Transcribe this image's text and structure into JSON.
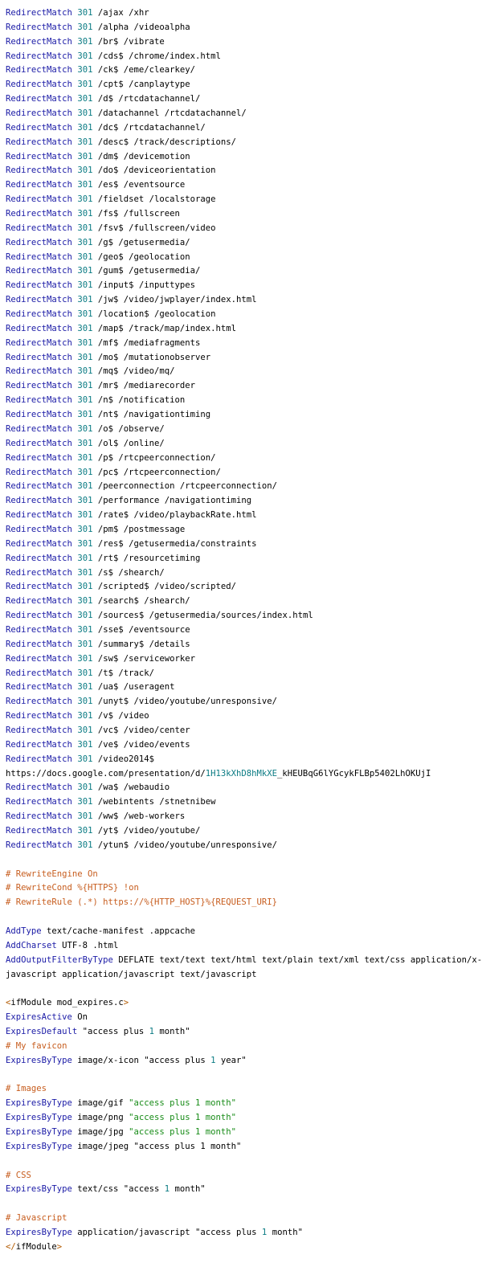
{
  "colors": {
    "background": "#ffffff",
    "keyword": "#1a1aa6",
    "number": "#0a7b83",
    "comment": "#c75d1e",
    "string": "#188c18",
    "tag": "#b35a00",
    "text": "#000000"
  },
  "lines": [
    [
      {
        "t": "RedirectMatch",
        "c": "kw"
      },
      {
        "t": " "
      },
      {
        "t": "301",
        "c": "num"
      },
      {
        "t": " /ajax /xhr"
      }
    ],
    [
      {
        "t": "RedirectMatch",
        "c": "kw"
      },
      {
        "t": " "
      },
      {
        "t": "301",
        "c": "num"
      },
      {
        "t": " /alpha /videoalpha"
      }
    ],
    [
      {
        "t": "RedirectMatch",
        "c": "kw"
      },
      {
        "t": " "
      },
      {
        "t": "301",
        "c": "num"
      },
      {
        "t": " /br$ /vibrate"
      }
    ],
    [
      {
        "t": "RedirectMatch",
        "c": "kw"
      },
      {
        "t": " "
      },
      {
        "t": "301",
        "c": "num"
      },
      {
        "t": " /cds$ /chrome/index.html"
      }
    ],
    [
      {
        "t": "RedirectMatch",
        "c": "kw"
      },
      {
        "t": " "
      },
      {
        "t": "301",
        "c": "num"
      },
      {
        "t": " /ck$ /eme/clearkey/"
      }
    ],
    [
      {
        "t": "RedirectMatch",
        "c": "kw"
      },
      {
        "t": " "
      },
      {
        "t": "301",
        "c": "num"
      },
      {
        "t": " /cpt$ /canplaytype"
      }
    ],
    [
      {
        "t": "RedirectMatch",
        "c": "kw"
      },
      {
        "t": " "
      },
      {
        "t": "301",
        "c": "num"
      },
      {
        "t": " /d$ /rtcdatachannel/"
      }
    ],
    [
      {
        "t": "RedirectMatch",
        "c": "kw"
      },
      {
        "t": " "
      },
      {
        "t": "301",
        "c": "num"
      },
      {
        "t": " /datachannel /rtcdatachannel/"
      }
    ],
    [
      {
        "t": "RedirectMatch",
        "c": "kw"
      },
      {
        "t": " "
      },
      {
        "t": "301",
        "c": "num"
      },
      {
        "t": " /dc$ /rtcdatachannel/"
      }
    ],
    [
      {
        "t": "RedirectMatch",
        "c": "kw"
      },
      {
        "t": " "
      },
      {
        "t": "301",
        "c": "num"
      },
      {
        "t": " /desc$ /track/descriptions/"
      }
    ],
    [
      {
        "t": "RedirectMatch",
        "c": "kw"
      },
      {
        "t": " "
      },
      {
        "t": "301",
        "c": "num"
      },
      {
        "t": " /dm$ /devicemotion"
      }
    ],
    [
      {
        "t": "RedirectMatch",
        "c": "kw"
      },
      {
        "t": " "
      },
      {
        "t": "301",
        "c": "num"
      },
      {
        "t": " /do$ /deviceorientation"
      }
    ],
    [
      {
        "t": "RedirectMatch",
        "c": "kw"
      },
      {
        "t": " "
      },
      {
        "t": "301",
        "c": "num"
      },
      {
        "t": " /es$ /eventsource"
      }
    ],
    [
      {
        "t": "RedirectMatch",
        "c": "kw"
      },
      {
        "t": " "
      },
      {
        "t": "301",
        "c": "num"
      },
      {
        "t": " /fieldset /localstorage"
      }
    ],
    [
      {
        "t": "RedirectMatch",
        "c": "kw"
      },
      {
        "t": " "
      },
      {
        "t": "301",
        "c": "num"
      },
      {
        "t": " /fs$ /fullscreen"
      }
    ],
    [
      {
        "t": "RedirectMatch",
        "c": "kw"
      },
      {
        "t": " "
      },
      {
        "t": "301",
        "c": "num"
      },
      {
        "t": " /fsv$ /fullscreen/video"
      }
    ],
    [
      {
        "t": "RedirectMatch",
        "c": "kw"
      },
      {
        "t": " "
      },
      {
        "t": "301",
        "c": "num"
      },
      {
        "t": " /g$ /getusermedia/"
      }
    ],
    [
      {
        "t": "RedirectMatch",
        "c": "kw"
      },
      {
        "t": " "
      },
      {
        "t": "301",
        "c": "num"
      },
      {
        "t": " /geo$ /geolocation"
      }
    ],
    [
      {
        "t": "RedirectMatch",
        "c": "kw"
      },
      {
        "t": " "
      },
      {
        "t": "301",
        "c": "num"
      },
      {
        "t": " /gum$ /getusermedia/"
      }
    ],
    [
      {
        "t": "RedirectMatch",
        "c": "kw"
      },
      {
        "t": " "
      },
      {
        "t": "301",
        "c": "num"
      },
      {
        "t": " /input$ /inputtypes"
      }
    ],
    [
      {
        "t": "RedirectMatch",
        "c": "kw"
      },
      {
        "t": " "
      },
      {
        "t": "301",
        "c": "num"
      },
      {
        "t": " /jw$ /video/jwplayer/index.html"
      }
    ],
    [
      {
        "t": "RedirectMatch",
        "c": "kw"
      },
      {
        "t": " "
      },
      {
        "t": "301",
        "c": "num"
      },
      {
        "t": " /location$ /geolocation"
      }
    ],
    [
      {
        "t": "RedirectMatch",
        "c": "kw"
      },
      {
        "t": " "
      },
      {
        "t": "301",
        "c": "num"
      },
      {
        "t": " /map$ /track/map/index.html"
      }
    ],
    [
      {
        "t": "RedirectMatch",
        "c": "kw"
      },
      {
        "t": " "
      },
      {
        "t": "301",
        "c": "num"
      },
      {
        "t": " /mf$ /mediafragments"
      }
    ],
    [
      {
        "t": "RedirectMatch",
        "c": "kw"
      },
      {
        "t": " "
      },
      {
        "t": "301",
        "c": "num"
      },
      {
        "t": " /mo$ /mutationobserver"
      }
    ],
    [
      {
        "t": "RedirectMatch",
        "c": "kw"
      },
      {
        "t": " "
      },
      {
        "t": "301",
        "c": "num"
      },
      {
        "t": " /mq$ /video/mq/"
      }
    ],
    [
      {
        "t": "RedirectMatch",
        "c": "kw"
      },
      {
        "t": " "
      },
      {
        "t": "301",
        "c": "num"
      },
      {
        "t": " /mr$ /mediarecorder"
      }
    ],
    [
      {
        "t": "RedirectMatch",
        "c": "kw"
      },
      {
        "t": " "
      },
      {
        "t": "301",
        "c": "num"
      },
      {
        "t": " /n$ /notification"
      }
    ],
    [
      {
        "t": "RedirectMatch",
        "c": "kw"
      },
      {
        "t": " "
      },
      {
        "t": "301",
        "c": "num"
      },
      {
        "t": " /nt$ /navigationtiming"
      }
    ],
    [
      {
        "t": "RedirectMatch",
        "c": "kw"
      },
      {
        "t": " "
      },
      {
        "t": "301",
        "c": "num"
      },
      {
        "t": " /o$ /observe/"
      }
    ],
    [
      {
        "t": "RedirectMatch",
        "c": "kw"
      },
      {
        "t": " "
      },
      {
        "t": "301",
        "c": "num"
      },
      {
        "t": " /ol$ /online/"
      }
    ],
    [
      {
        "t": "RedirectMatch",
        "c": "kw"
      },
      {
        "t": " "
      },
      {
        "t": "301",
        "c": "num"
      },
      {
        "t": " /p$ /rtcpeerconnection/"
      }
    ],
    [
      {
        "t": "RedirectMatch",
        "c": "kw"
      },
      {
        "t": " "
      },
      {
        "t": "301",
        "c": "num"
      },
      {
        "t": " /pc$ /rtcpeerconnection/"
      }
    ],
    [
      {
        "t": "RedirectMatch",
        "c": "kw"
      },
      {
        "t": " "
      },
      {
        "t": "301",
        "c": "num"
      },
      {
        "t": " /peerconnection /rtcpeerconnection/"
      }
    ],
    [
      {
        "t": "RedirectMatch",
        "c": "kw"
      },
      {
        "t": " "
      },
      {
        "t": "301",
        "c": "num"
      },
      {
        "t": " /performance /navigationtiming"
      }
    ],
    [
      {
        "t": "RedirectMatch",
        "c": "kw"
      },
      {
        "t": " "
      },
      {
        "t": "301",
        "c": "num"
      },
      {
        "t": " /rate$ /video/playbackRate.html"
      }
    ],
    [
      {
        "t": "RedirectMatch",
        "c": "kw"
      },
      {
        "t": " "
      },
      {
        "t": "301",
        "c": "num"
      },
      {
        "t": " /pm$ /postmessage"
      }
    ],
    [
      {
        "t": "RedirectMatch",
        "c": "kw"
      },
      {
        "t": " "
      },
      {
        "t": "301",
        "c": "num"
      },
      {
        "t": " /res$ /getusermedia/constraints"
      }
    ],
    [
      {
        "t": "RedirectMatch",
        "c": "kw"
      },
      {
        "t": " "
      },
      {
        "t": "301",
        "c": "num"
      },
      {
        "t": " /rt$ /resourcetiming"
      }
    ],
    [
      {
        "t": "RedirectMatch",
        "c": "kw"
      },
      {
        "t": " "
      },
      {
        "t": "301",
        "c": "num"
      },
      {
        "t": " /s$ /shearch/"
      }
    ],
    [
      {
        "t": "RedirectMatch",
        "c": "kw"
      },
      {
        "t": " "
      },
      {
        "t": "301",
        "c": "num"
      },
      {
        "t": " /scripted$ /video/scripted/"
      }
    ],
    [
      {
        "t": "RedirectMatch",
        "c": "kw"
      },
      {
        "t": " "
      },
      {
        "t": "301",
        "c": "num"
      },
      {
        "t": " /search$ /shearch/"
      }
    ],
    [
      {
        "t": "RedirectMatch",
        "c": "kw"
      },
      {
        "t": " "
      },
      {
        "t": "301",
        "c": "num"
      },
      {
        "t": " /sources$ /getusermedia/sources/index.html"
      }
    ],
    [
      {
        "t": "RedirectMatch",
        "c": "kw"
      },
      {
        "t": " "
      },
      {
        "t": "301",
        "c": "num"
      },
      {
        "t": " /sse$ /eventsource"
      }
    ],
    [
      {
        "t": "RedirectMatch",
        "c": "kw"
      },
      {
        "t": " "
      },
      {
        "t": "301",
        "c": "num"
      },
      {
        "t": " /summary$ /details"
      }
    ],
    [
      {
        "t": "RedirectMatch",
        "c": "kw"
      },
      {
        "t": " "
      },
      {
        "t": "301",
        "c": "num"
      },
      {
        "t": " /sw$ /serviceworker"
      }
    ],
    [
      {
        "t": "RedirectMatch",
        "c": "kw"
      },
      {
        "t": " "
      },
      {
        "t": "301",
        "c": "num"
      },
      {
        "t": " /t$ /track/"
      }
    ],
    [
      {
        "t": "RedirectMatch",
        "c": "kw"
      },
      {
        "t": " "
      },
      {
        "t": "301",
        "c": "num"
      },
      {
        "t": " /ua$ /useragent"
      }
    ],
    [
      {
        "t": "RedirectMatch",
        "c": "kw"
      },
      {
        "t": " "
      },
      {
        "t": "301",
        "c": "num"
      },
      {
        "t": " /unyt$ /video/youtube/unresponsive/"
      }
    ],
    [
      {
        "t": "RedirectMatch",
        "c": "kw"
      },
      {
        "t": " "
      },
      {
        "t": "301",
        "c": "num"
      },
      {
        "t": " /v$ /video"
      }
    ],
    [
      {
        "t": "RedirectMatch",
        "c": "kw"
      },
      {
        "t": " "
      },
      {
        "t": "301",
        "c": "num"
      },
      {
        "t": " /vc$ /video/center"
      }
    ],
    [
      {
        "t": "RedirectMatch",
        "c": "kw"
      },
      {
        "t": " "
      },
      {
        "t": "301",
        "c": "num"
      },
      {
        "t": " /ve$ /video/events"
      }
    ],
    [
      {
        "t": "RedirectMatch",
        "c": "kw"
      },
      {
        "t": " "
      },
      {
        "t": "301",
        "c": "num"
      },
      {
        "t": " /video2014$"
      }
    ],
    [
      {
        "t": "https://docs.google.com/presentation/d/"
      },
      {
        "t": "1H13kXhD8hMkXE",
        "c": "lnk"
      },
      {
        "t": "_kHEUBqG6lYGcykFLBp5402LhOKUjI"
      }
    ],
    [
      {
        "t": "RedirectMatch",
        "c": "kw"
      },
      {
        "t": " "
      },
      {
        "t": "301",
        "c": "num"
      },
      {
        "t": " /wa$ /webaudio"
      }
    ],
    [
      {
        "t": "RedirectMatch",
        "c": "kw"
      },
      {
        "t": " "
      },
      {
        "t": "301",
        "c": "num"
      },
      {
        "t": " /webintents /stnetnibew"
      }
    ],
    [
      {
        "t": "RedirectMatch",
        "c": "kw"
      },
      {
        "t": " "
      },
      {
        "t": "301",
        "c": "num"
      },
      {
        "t": " /ww$ /web-workers"
      }
    ],
    [
      {
        "t": "RedirectMatch",
        "c": "kw"
      },
      {
        "t": " "
      },
      {
        "t": "301",
        "c": "num"
      },
      {
        "t": " /yt$ /video/youtube/"
      }
    ],
    [
      {
        "t": "RedirectMatch",
        "c": "kw"
      },
      {
        "t": " "
      },
      {
        "t": "301",
        "c": "num"
      },
      {
        "t": " /ytun$ /video/youtube/unresponsive/"
      }
    ],
    [],
    [
      {
        "t": "# RewriteEngine On",
        "c": "cm"
      }
    ],
    [
      {
        "t": "# RewriteCond %{HTTPS} !on",
        "c": "cm"
      }
    ],
    [
      {
        "t": "# RewriteRule (.*) https://%{HTTP_HOST}%{REQUEST_URI}",
        "c": "cm"
      }
    ],
    [],
    [
      {
        "t": "AddType",
        "c": "kw"
      },
      {
        "t": " text/cache-manifest .appcache"
      }
    ],
    [
      {
        "t": "AddCharset",
        "c": "kw"
      },
      {
        "t": " UTF-8 .html"
      }
    ],
    [
      {
        "t": "AddOutputFilterByType",
        "c": "kw"
      },
      {
        "t": " DEFLATE text/text text/html text/plain text/xml text/css application/x-"
      }
    ],
    [
      {
        "t": "javascript application/javascript text/javascript"
      }
    ],
    [],
    [
      {
        "t": "<",
        "c": "ang"
      },
      {
        "t": "ifModule mod_expires.c"
      },
      {
        "t": ">",
        "c": "ang"
      }
    ],
    [
      {
        "t": "ExpiresActive",
        "c": "kw"
      },
      {
        "t": " On"
      }
    ],
    [
      {
        "t": "ExpiresDefault",
        "c": "kw"
      },
      {
        "t": " \"access plus "
      },
      {
        "t": "1",
        "c": "num"
      },
      {
        "t": " month\""
      }
    ],
    [
      {
        "t": "# My favicon",
        "c": "cm"
      }
    ],
    [
      {
        "t": "ExpiresByType",
        "c": "kw"
      },
      {
        "t": " image/x-icon \"access plus "
      },
      {
        "t": "1",
        "c": "num"
      },
      {
        "t": " year\""
      }
    ],
    [],
    [
      {
        "t": "# Images",
        "c": "cm"
      }
    ],
    [
      {
        "t": "ExpiresByType",
        "c": "kw"
      },
      {
        "t": " image/gif "
      },
      {
        "t": "\"access plus 1 month\"",
        "c": "st"
      }
    ],
    [
      {
        "t": "ExpiresByType",
        "c": "kw"
      },
      {
        "t": " image/png "
      },
      {
        "t": "\"access plus 1 month\"",
        "c": "st"
      }
    ],
    [
      {
        "t": "ExpiresByType",
        "c": "kw"
      },
      {
        "t": " image/jpg "
      },
      {
        "t": "\"access plus 1 month\"",
        "c": "st"
      }
    ],
    [
      {
        "t": "ExpiresByType",
        "c": "kw"
      },
      {
        "t": " image/jpeg \"access plus 1 month\""
      }
    ],
    [],
    [
      {
        "t": "# CSS",
        "c": "cm"
      }
    ],
    [
      {
        "t": "ExpiresByType",
        "c": "kw"
      },
      {
        "t": " text/css \"access "
      },
      {
        "t": "1",
        "c": "num"
      },
      {
        "t": " month\""
      }
    ],
    [],
    [
      {
        "t": "# Javascript",
        "c": "cm"
      }
    ],
    [
      {
        "t": "ExpiresByType",
        "c": "kw"
      },
      {
        "t": " application/javascript \"access plus "
      },
      {
        "t": "1",
        "c": "num"
      },
      {
        "t": " month\""
      }
    ],
    [
      {
        "t": "</",
        "c": "ang"
      },
      {
        "t": "ifModule"
      },
      {
        "t": ">",
        "c": "ang"
      }
    ]
  ]
}
